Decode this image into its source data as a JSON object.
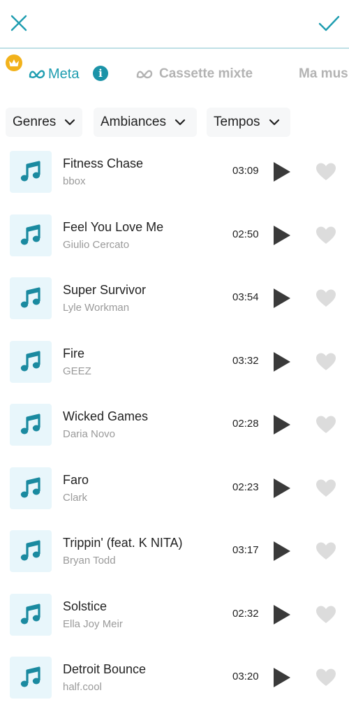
{
  "header": {
    "close_icon": "close-icon",
    "confirm_icon": "check-icon",
    "accent_color": "#1e9db0"
  },
  "tabs": {
    "meta": {
      "label": "Meta",
      "active": true
    },
    "cassette": {
      "label": "Cassette mixte"
    },
    "ma_musique": {
      "label": "Ma mus"
    }
  },
  "filters": {
    "genres": "Genres",
    "ambiances": "Ambiances",
    "tempos": "Tempos"
  },
  "tracks": [
    {
      "title": "Fitness Chase",
      "artist": "bbox",
      "duration": "03:09"
    },
    {
      "title": "Feel You Love Me",
      "artist": "Giulio Cercato",
      "duration": "02:50"
    },
    {
      "title": "Super Survivor",
      "artist": "Lyle Workman",
      "duration": "03:54"
    },
    {
      "title": "Fire",
      "artist": "GEEZ",
      "duration": "03:32"
    },
    {
      "title": "Wicked Games",
      "artist": "Daria Novo",
      "duration": "02:28"
    },
    {
      "title": "Faro",
      "artist": "Clark",
      "duration": "02:23"
    },
    {
      "title": "Trippin' (feat. K NITA)",
      "artist": "Bryan Todd",
      "duration": "03:17"
    },
    {
      "title": "Solstice",
      "artist": "Ella Joy Meir",
      "duration": "02:32"
    },
    {
      "title": "Detroit Bounce",
      "artist": "half.cool",
      "duration": "03:20"
    }
  ]
}
